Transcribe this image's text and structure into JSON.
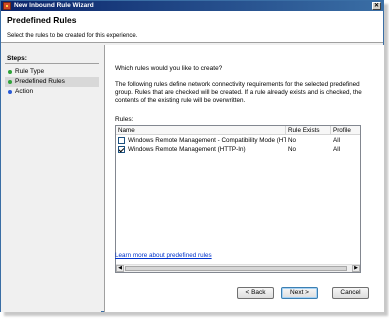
{
  "window": {
    "title": "New Inbound Rule Wizard",
    "close_glyph": "✕"
  },
  "header": {
    "title": "Predefined Rules",
    "subtitle": "Select the rules to be created for this experience."
  },
  "steps": {
    "title": "Steps:",
    "items": [
      {
        "label": "Rule Type",
        "bullet": "green"
      },
      {
        "label": "Predefined Rules",
        "bullet": "green",
        "current": true
      },
      {
        "label": "Action",
        "bullet": "blue"
      }
    ]
  },
  "main": {
    "question": "Which rules would you like to create?",
    "description": "The following rules define network connectivity requirements for the selected predefined group. Rules that are checked will be created. If a rule already exists and is checked, the contents of the existing rule will be overwritten.",
    "rules_label": "Rules:",
    "columns": [
      "Name",
      "Rule Exists",
      "Profile"
    ],
    "rows": [
      {
        "checked": false,
        "name": "Windows Remote Management - Compatibility Mode (HTTP-In)",
        "exists": "No",
        "profile": "All"
      },
      {
        "checked": true,
        "name": "Windows Remote Management (HTTP-In)",
        "exists": "No",
        "profile": "All"
      }
    ],
    "learn_link": "Learn more about predefined rules"
  },
  "buttons": {
    "back": "< Back",
    "next": "Next >",
    "cancel": "Cancel"
  },
  "colors": {
    "titlebar_start": "#0a246a",
    "titlebar_end": "#3a6ea5",
    "link": "#0033cc"
  }
}
